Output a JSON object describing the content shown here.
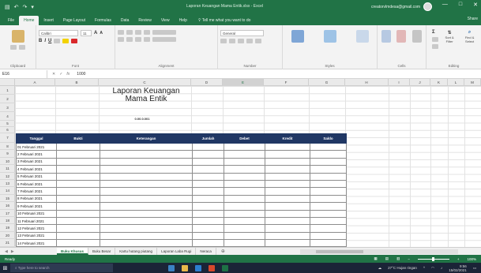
{
  "app": {
    "title": "Laporan Keuangan Mama Entik.xlsx - Excel",
    "user": "creatorvlmdesa@gmail.com",
    "brand_color": "#217346"
  },
  "qat": {
    "save_icon": "save-icon",
    "undo_icon": "undo-icon",
    "redo_icon": "redo-icon"
  },
  "window": {
    "minimize": "—",
    "maximize": "□",
    "close": "✕"
  },
  "tabs": [
    {
      "label": "File"
    },
    {
      "label": "Home"
    },
    {
      "label": "Insert"
    },
    {
      "label": "Page Layout"
    },
    {
      "label": "Formulas"
    },
    {
      "label": "Data"
    },
    {
      "label": "Review"
    },
    {
      "label": "View"
    },
    {
      "label": "Help"
    }
  ],
  "tellme": "Tell me what you want to do",
  "share": "Share",
  "ribbon": {
    "clipboard": "Clipboard",
    "font": "Font",
    "font_name": "Calibri",
    "font_size": "11",
    "alignment": "Alignment",
    "number": "Number",
    "number_format": "General",
    "styles": "Styles",
    "cells": "Cells",
    "editing": "Editing",
    "sort_filter": "Sort & Filter",
    "find_select": "Find & Select"
  },
  "formula": {
    "namebox": "E16",
    "content": "1000"
  },
  "columns": [
    "A",
    "B",
    "C",
    "D",
    "E",
    "F",
    "G",
    "H",
    "I",
    "J",
    "K",
    "L",
    "M"
  ],
  "rows": [
    "1",
    "2",
    "3",
    "4",
    "5",
    "6",
    "7",
    "8",
    "9",
    "10",
    "11",
    "12",
    "13",
    "14",
    "15",
    "16",
    "17",
    "18",
    "19",
    "20",
    "21"
  ],
  "report": {
    "title_line1": "Laporan Keuangan",
    "title_line2": "Mama Entik",
    "subtitle": "0.00.0.001"
  },
  "table": {
    "headers": [
      "Tanggal",
      "Bukti",
      "Keterangan",
      "Jumlah",
      "Debet",
      "Kredit",
      "Saldo"
    ],
    "rows": [
      [
        "01 Februari 2021"
      ],
      [
        "2 Februari 2021"
      ],
      [
        "3 Februari 2021"
      ],
      [
        "4 Februari 2021"
      ],
      [
        "5 Februari 2021"
      ],
      [
        "6 Februari 2021"
      ],
      [
        "7 Februari 2021"
      ],
      [
        "8 Februari 2021"
      ],
      [
        "9 Februari 2021"
      ],
      [
        "10 Februari 2021"
      ],
      [
        "11 Februari 2021"
      ],
      [
        "12 Februari 2021"
      ],
      [
        "13 Februari 2021"
      ],
      [
        "14 Februari 2021"
      ]
    ]
  },
  "sheets": [
    {
      "label": "Buku Khusus"
    },
    {
      "label": "Buku Besar"
    },
    {
      "label": "Kartu hutang piutang"
    },
    {
      "label": "Laporan Laba Rugi"
    },
    {
      "label": "Neraca"
    }
  ],
  "status": {
    "ready": "Ready",
    "zoom": "100%"
  },
  "taskbar": {
    "search": "Type here to search",
    "weather": "27°C Hujan ringan",
    "time": "9:56",
    "date": "15/02/2021"
  }
}
